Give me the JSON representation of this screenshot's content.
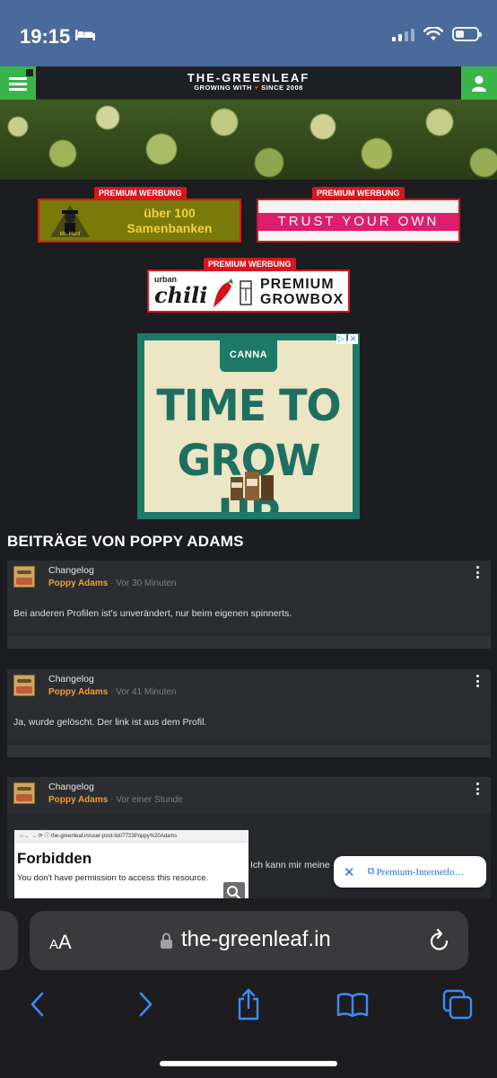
{
  "status_bar": {
    "time": "19:15",
    "icons": [
      "bed-icon",
      "signal-icon",
      "wifi-icon",
      "battery-icon"
    ]
  },
  "site": {
    "logo_title": "THE-GREENLEAF",
    "logo_sub_left": "GROWING WITH",
    "logo_sub_right": "SINCE 2008",
    "accent": "#39b54a"
  },
  "ads": {
    "premium_label": "PREMIUM WERBUNG",
    "ad1_text_1": "über 100",
    "ad1_text_2": "Samenbanken",
    "ad1_mascot": "Mr. Hanf",
    "ad2_text": "TRUST YOUR OWN",
    "ad3_urban": "urban",
    "ad3_chili": "chili",
    "ad3_premium": "PREMIUM",
    "ad3_growbox": "GROWBOX",
    "canna_brand": "CANNA",
    "canna_line1": "TIME TO",
    "canna_line2": "GROW UP"
  },
  "section_title": "BEITRÄGE VON POPPY ADAMS",
  "posts": [
    {
      "thread": "Changelog",
      "author": "Poppy Adams",
      "sep": "·",
      "time": "Vor 30 Minuten",
      "body": "Bei anderen Profilen ist's unverändert, nur beim eigenen spinnerts."
    },
    {
      "thread": "Changelog",
      "author": "Poppy Adams",
      "sep": "·",
      "time": "Vor 41 Minuten",
      "body": "Ja, wurde gelöscht. Der link ist aus dem Profil."
    },
    {
      "thread": "Changelog",
      "author": "Poppy Adams",
      "sep": "·",
      "time": "Vor einer Stunde",
      "body": "Ich kann mir meine"
    }
  ],
  "embedded_shot": {
    "url": "the-greenleaf.in/user-post-list/7723Poppy%20Adams",
    "heading": "Forbidden",
    "text": "You don't have permission to access this resource."
  },
  "popup": {
    "text": "Premium-Internetfo…"
  },
  "safari": {
    "aa_small": "A",
    "aa_big": "A",
    "url": "the-greenleaf.in"
  }
}
